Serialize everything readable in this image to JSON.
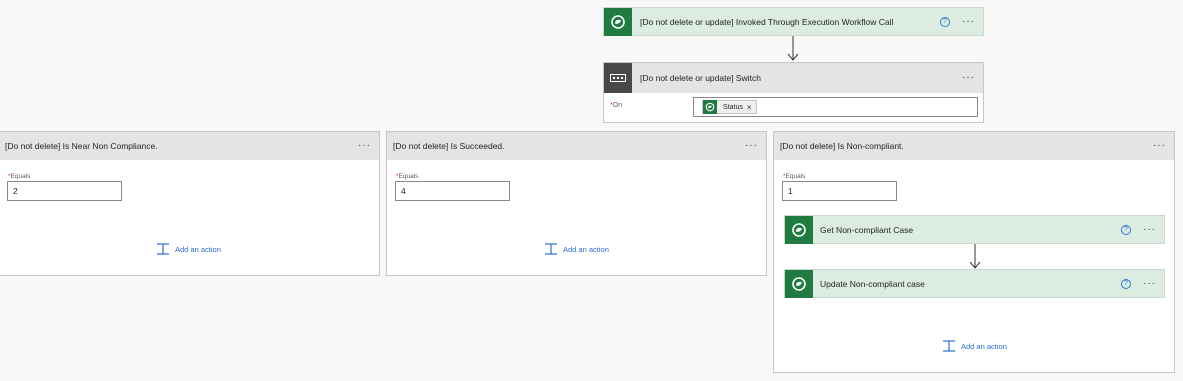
{
  "trigger": {
    "title": "[Do not delete or update] Invoked Through Execution Workflow Call",
    "help": "?",
    "more": "···",
    "icon": "dataverse-icon"
  },
  "switch": {
    "title": "[Do not delete or update] Switch",
    "more": "···",
    "icon": "switch-icon",
    "on_label": "On",
    "required_mark": "*",
    "token_label": "Status",
    "token_remove": "×"
  },
  "cases": [
    {
      "title": "[Do not delete] Is Near Non Compliance.",
      "more": "···",
      "equals_label": "Equals",
      "equals_value": "2",
      "add_action": "Add an action"
    },
    {
      "title": "[Do not delete] Is Succeeded.",
      "more": "···",
      "equals_label": "Equals",
      "equals_value": "4",
      "add_action": "Add an action"
    },
    {
      "title": "[Do not delete] Is Non-compliant.",
      "more": "···",
      "equals_label": "Equals",
      "equals_value": "1",
      "add_action": "Add an action",
      "actions": [
        {
          "title": "Get Non-compliant Case",
          "help": "?",
          "more": "···"
        },
        {
          "title": "Update Non-compliant case",
          "help": "?",
          "more": "···"
        }
      ]
    }
  ],
  "required_mark": "*",
  "colors": {
    "dataverse_green": "#1f7b3f",
    "action_header_bg": "#dcece1",
    "case_header_bg": "#e4e4e4",
    "link_blue": "#2b6dd5",
    "switch_icon_bg": "#484848"
  }
}
